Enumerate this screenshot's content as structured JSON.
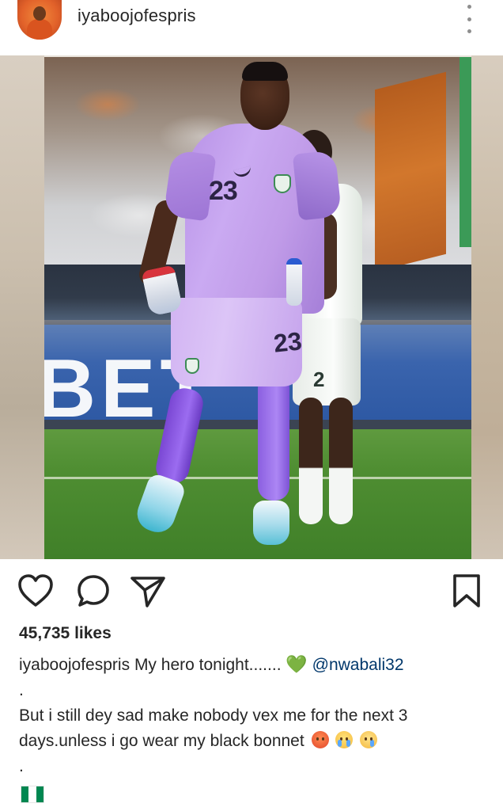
{
  "post": {
    "username": "iyaboojofespris",
    "likes_text": "45,735 likes",
    "caption": {
      "owner": "iyaboojofespris",
      "text_1": "My hero tonight.......",
      "heart_emoji": "💚",
      "mention": "@nwabali32",
      "dot_1": ".",
      "text_2": "But i still dey sad make nobody vex me for the next 3",
      "text_3": "days.unless i go wear my black bonnet",
      "dot_2": "."
    },
    "image": {
      "player_number": "23",
      "shorts_number": "23",
      "teammate_number": "2",
      "banner_text": "BET"
    }
  },
  "icons": {
    "avatar": "avatar",
    "more": "more-vertical-icon",
    "like": "heart-outline-icon",
    "comment": "comment-bubble-icon",
    "share": "paper-plane-icon",
    "save": "bookmark-icon",
    "caption_emojis": [
      "angry-face-icon",
      "loudly-crying-face-icon",
      "crying-face-icon"
    ],
    "flag": "nigeria-flag-icon"
  },
  "colors": {
    "text": "#262626",
    "mention": "#00376b",
    "kit_purple": "#c9a9f1",
    "flag_green": "#008751"
  }
}
